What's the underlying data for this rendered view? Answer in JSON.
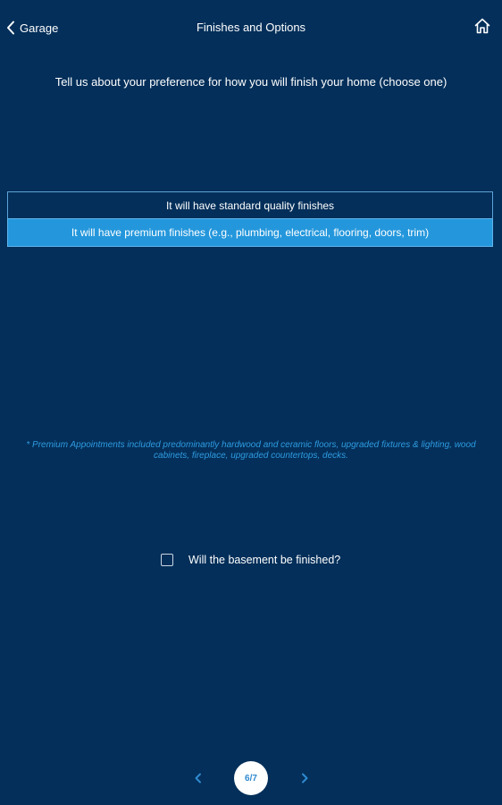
{
  "header": {
    "back_label": "Garage",
    "title": "Finishes and Options",
    "back_icon": "chevron-left-icon",
    "home_icon": "home-icon"
  },
  "question": {
    "prompt": "Tell us about your preference for how you will finish your home (choose one)"
  },
  "options": [
    {
      "label": "It will have standard quality finishes",
      "selected": false
    },
    {
      "label": "It will have premium finishes (e.g., plumbing, electrical, flooring, doors, trim)",
      "selected": true
    }
  ],
  "footnote": "* Premium Appointments included predominantly hardwood and ceramic floors, upgraded fixtures & lighting, wood cabinets, fireplace, upgraded countertops, decks.",
  "basement": {
    "label": "Will the basement be finished?",
    "checked": false
  },
  "pager": {
    "indicator": "6/7",
    "prev_icon": "chevron-left-icon",
    "next_icon": "chevron-right-icon"
  },
  "colors": {
    "background": "#032f5a",
    "selected_option": "#2497dc",
    "footnote": "#2f9be0",
    "pager_text": "#2f8ad0"
  }
}
